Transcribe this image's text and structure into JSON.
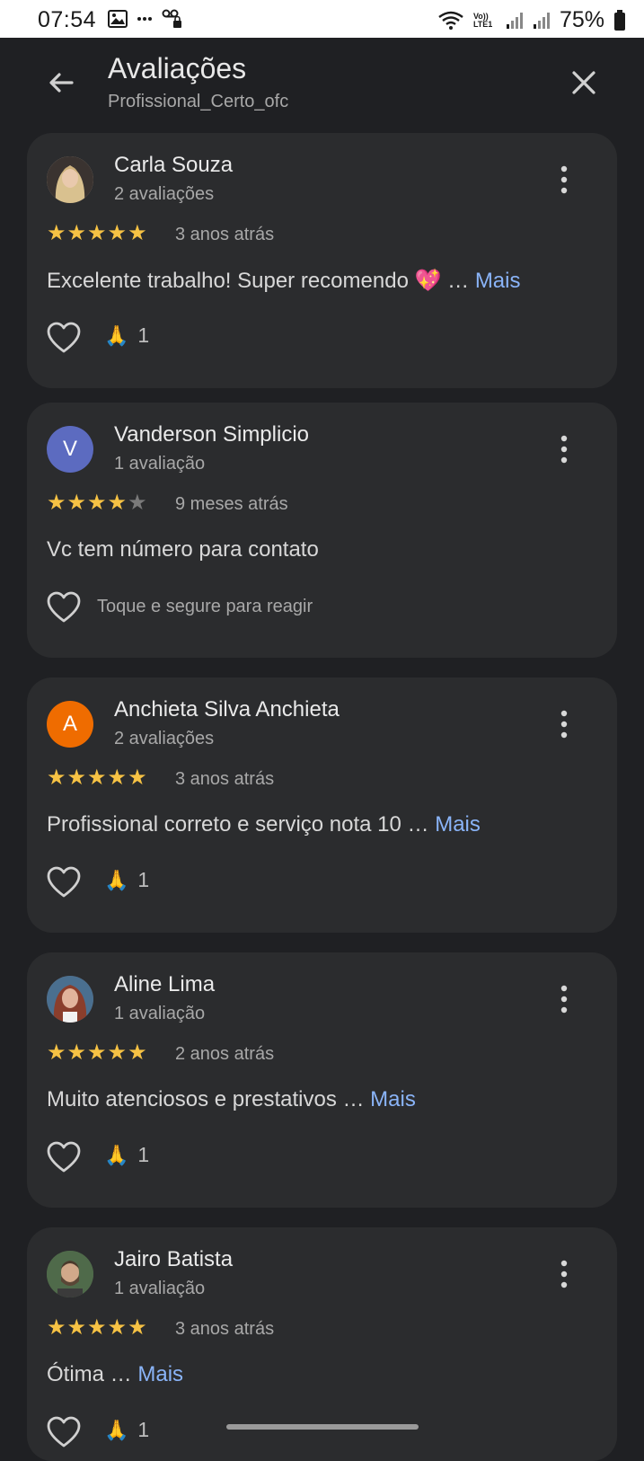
{
  "status_bar": {
    "time": "07:54",
    "battery": "75%",
    "icons": [
      "image-icon",
      "more-dots-icon",
      "voicemail-lock-icon",
      "wifi-icon",
      "volte-icon",
      "signal-icon",
      "signal-icon",
      "battery-icon"
    ],
    "volte_label": "Vo)) LTE1"
  },
  "header": {
    "title": "Avaliações",
    "subtitle": "Profissional_Certo_ofc",
    "back_icon": "arrow-back-icon",
    "close_icon": "close-icon"
  },
  "colors": {
    "background": "#1f2023",
    "card": "#2b2c2e",
    "star": "#f6c244",
    "link": "#8ab4f8",
    "avatar_v": "#5c6bc0",
    "avatar_a": "#ef6c00"
  },
  "reviews": [
    {
      "name": "Carla Souza",
      "count": "2 avaliações",
      "rating": 5,
      "date": "3 anos atrás",
      "text": "Excelente trabalho! Super recomendo 💖 …",
      "more": "Mais",
      "reaction_emoji": "🙏",
      "reaction_count": "1",
      "avatar": "photo"
    },
    {
      "name": "Vanderson Simplicio",
      "count": "1 avaliação",
      "rating": 4,
      "date": "9 meses atrás",
      "text": "Vc tem número para contato",
      "hint": "Toque e segure para reagir",
      "avatar_letter": "V"
    },
    {
      "name": "Anchieta Silva Anchieta",
      "count": "2 avaliações",
      "rating": 5,
      "date": "3 anos atrás",
      "text": "Profissional correto e serviço nota 10 …",
      "more": "Mais",
      "reaction_emoji": "🙏",
      "reaction_count": "1",
      "avatar_letter": "A"
    },
    {
      "name": "Aline Lima",
      "count": "1 avaliação",
      "rating": 5,
      "date": "2 anos atrás",
      "text": "Muito atenciosos e prestativos …",
      "more": "Mais",
      "reaction_emoji": "🙏",
      "reaction_count": "1",
      "avatar": "photo"
    },
    {
      "name": "Jairo Batista",
      "count": "1 avaliação",
      "rating": 5,
      "date": "3 anos atrás",
      "text": "Ótima …",
      "more": "Mais",
      "reaction_emoji": "🙏",
      "reaction_count": "1",
      "avatar": "photo"
    }
  ]
}
